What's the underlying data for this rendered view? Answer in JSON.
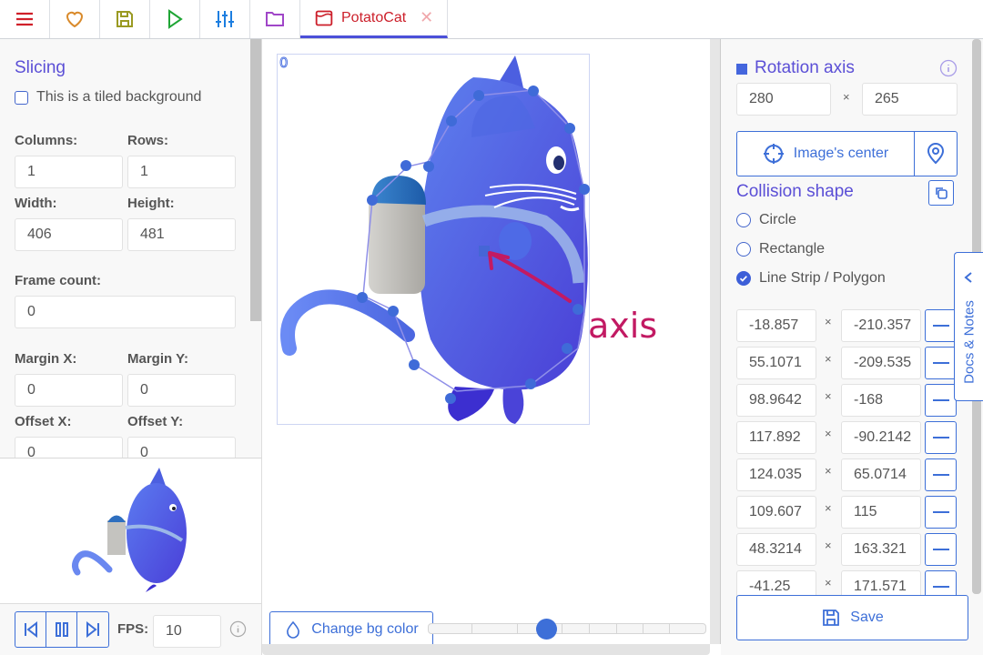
{
  "toolbar": {
    "buttons": [
      {
        "icon": "menu-icon",
        "color": "#d0202a"
      },
      {
        "icon": "heart-icon",
        "color": "#d98a2b"
      },
      {
        "icon": "save-icon",
        "color": "#9a9a22"
      },
      {
        "icon": "play-icon",
        "color": "#1fa535"
      },
      {
        "icon": "sliders-icon",
        "color": "#1c7ee0"
      },
      {
        "icon": "folder-icon",
        "color": "#a046c8"
      }
    ],
    "tab": {
      "label": "PotatoCat",
      "icon": "texture-icon",
      "close": "✕",
      "color": "#cc1f2a"
    }
  },
  "slicing": {
    "title": "Slicing",
    "tiled_label": "This is a tiled background",
    "tiled_checked": false,
    "columns_label": "Columns:",
    "columns": "1",
    "rows_label": "Rows:",
    "rows": "1",
    "width_label": "Width:",
    "width": "406",
    "height_label": "Height:",
    "height": "481",
    "frame_count_label": "Frame count:",
    "frame_count": "0",
    "margin_x_label": "Margin X:",
    "margin_x": "0",
    "margin_y_label": "Margin Y:",
    "margin_y": "0",
    "offset_x_label": "Offset X:",
    "offset_x": "0",
    "offset_y_label": "Offset Y:",
    "offset_y": "0"
  },
  "player": {
    "fps_label": "FPS:",
    "fps": "10"
  },
  "canvas": {
    "frame_index": "0",
    "annotation": "axis",
    "change_bg_label": "Change bg color",
    "zoom_slider_fraction": 0.42
  },
  "rotation": {
    "title": "Rotation axis",
    "x": "280",
    "y": "265",
    "times": "×",
    "center_label": "Image's center"
  },
  "collision": {
    "title": "Collision shape",
    "options": [
      {
        "label": "Circle",
        "checked": false
      },
      {
        "label": "Rectangle",
        "checked": false
      },
      {
        "label": "Line Strip / Polygon",
        "checked": true
      }
    ],
    "points": [
      {
        "x": "-18.857",
        "y": "-210.357"
      },
      {
        "x": "55.1071",
        "y": "-209.535"
      },
      {
        "x": "98.9642",
        "y": "-168"
      },
      {
        "x": "117.892",
        "y": "-90.2142"
      },
      {
        "x": "124.035",
        "y": "65.0714"
      },
      {
        "x": "109.607",
        "y": "115"
      },
      {
        "x": "48.3214",
        "y": "163.321"
      },
      {
        "x": "-41.25",
        "y": "171.571"
      }
    ],
    "save_label": "Save"
  },
  "docs": {
    "label": "Docs & Notes"
  },
  "colors": {
    "accent": "#3d6fd8",
    "title": "#5b4fd6",
    "tab_underline": "#4b4fd8"
  }
}
